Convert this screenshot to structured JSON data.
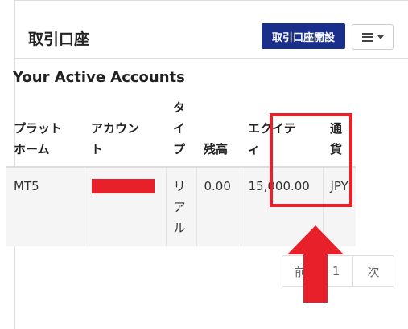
{
  "header": {
    "title": "取引口座",
    "open_account_label": "取引口座開設",
    "menu_icon": "hamburger-icon",
    "caret_icon": "caret-down-icon"
  },
  "section": {
    "title": "Your Active Accounts"
  },
  "table": {
    "headers": {
      "platform": "プラット\nホーム",
      "account": "アカウン\nト",
      "type": "タ\nイ\nプ",
      "balance": "残高",
      "equity": "エクイテ\nィ",
      "currency": "通\n貨"
    },
    "rows": [
      {
        "platform": "MT5",
        "type": "リ\nア\nル",
        "balance": "0.00",
        "equity": "15,000.00",
        "currency": "JPY"
      }
    ]
  },
  "pagination": {
    "prev_label": "前",
    "page": "1",
    "next_label": "次"
  },
  "colors": {
    "primary_button": "#1a2e8c",
    "annotation_red": "#e8202a",
    "row_background": "#f5f5f5"
  }
}
